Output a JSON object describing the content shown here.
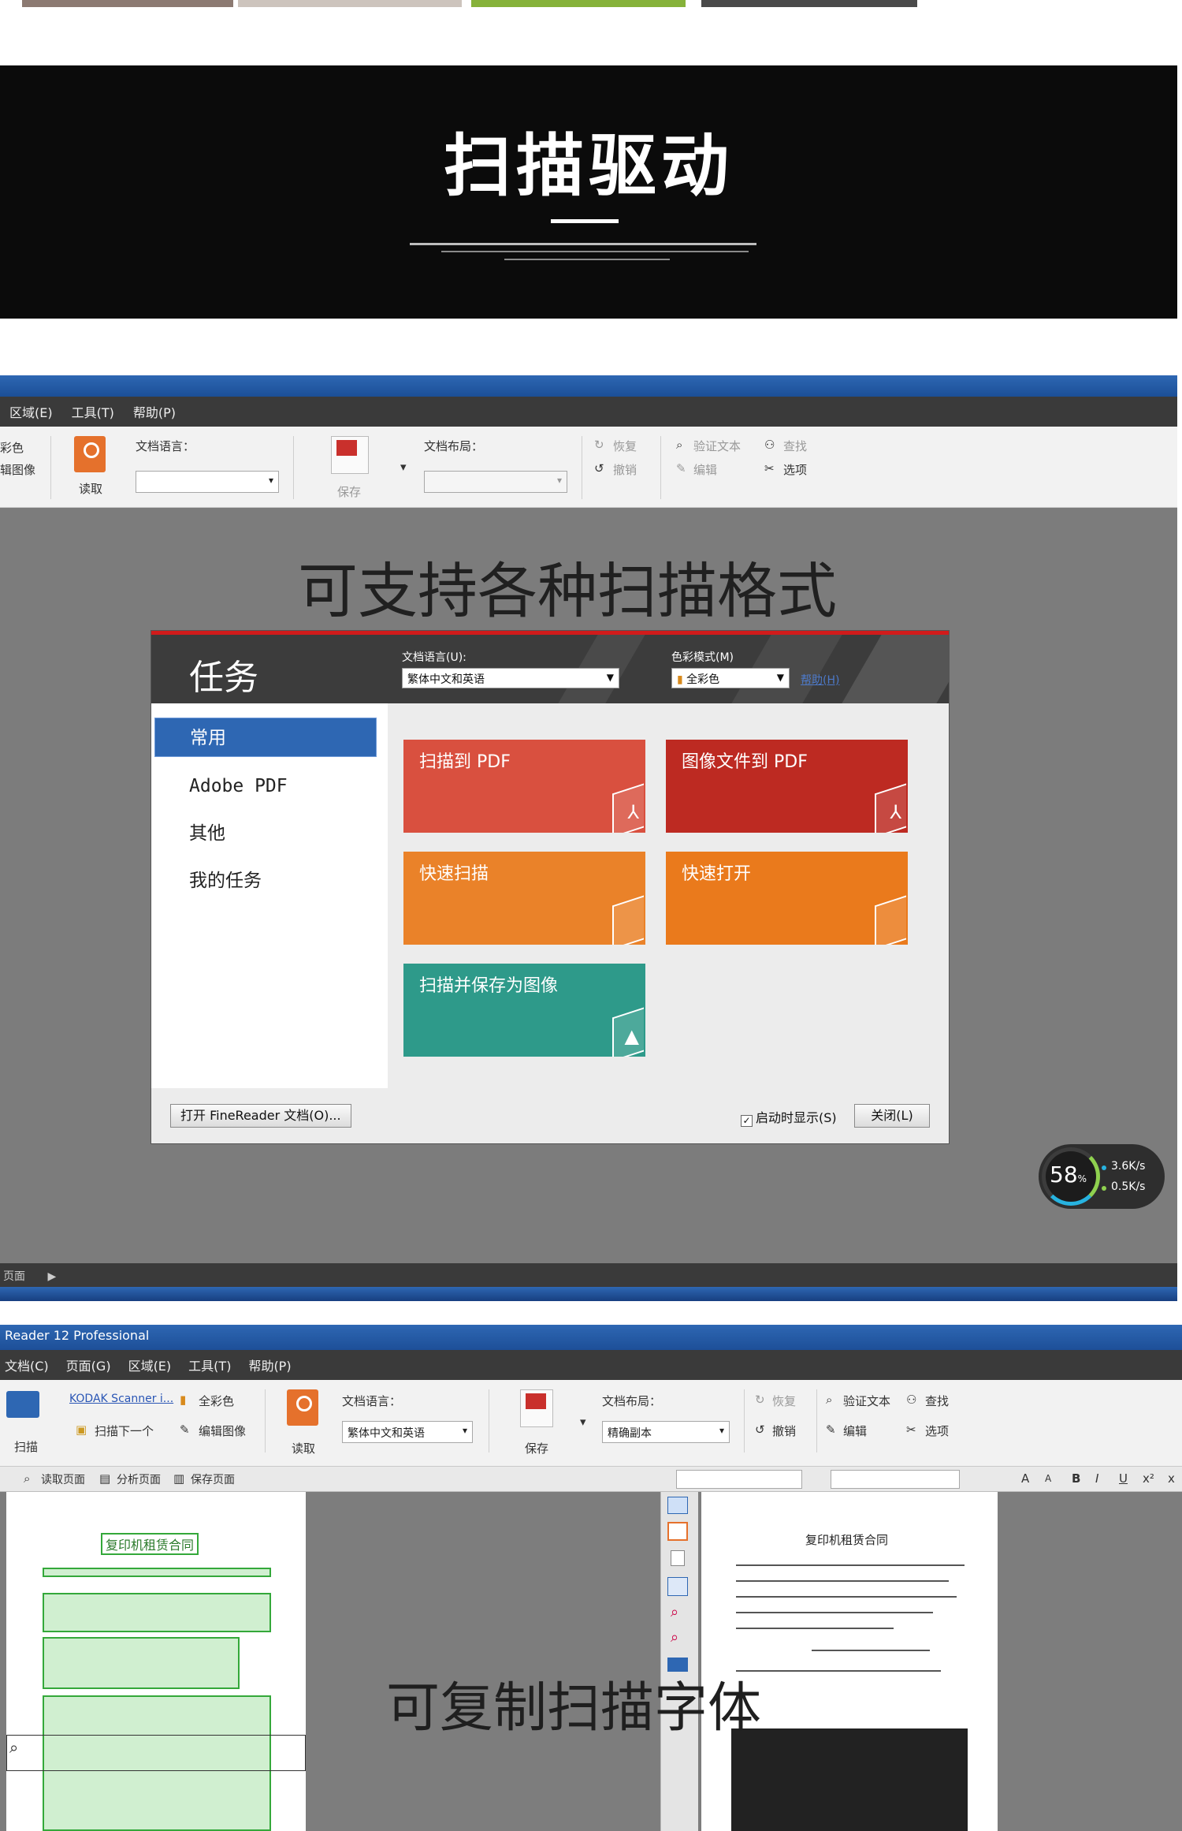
{
  "banner": {
    "title": "扫描驱动"
  },
  "shot1": {
    "menu": [
      "区域(E)",
      "工具(T)",
      "帮助(P)"
    ],
    "ribbon": {
      "left_cut_a": "彩色",
      "left_cut_b": "辑图像",
      "read_label": "读取",
      "doc_lang_label": "文档语言：",
      "save_label": "保存",
      "layout_label": "文档布局：",
      "redo_label": "恢复",
      "undo_label": "撤销",
      "verify_label": "验证文本",
      "edit_label": "编辑",
      "find_label": "查找",
      "options_label": "选项"
    },
    "heading": "可支持各种扫描格式",
    "dialog": {
      "title": "任务",
      "doc_lang_label": "文档语言(U):",
      "doc_lang_value": "繁体中文和英语",
      "color_mode_label": "色彩模式(M)",
      "color_mode_value": "全彩色",
      "help_link": "帮助(H)",
      "nav": [
        "常用",
        "Adobe PDF",
        "其他",
        "我的任务"
      ],
      "tiles": [
        {
          "label": "扫描到 PDF",
          "color": "#d9503f"
        },
        {
          "label": "图像文件到 PDF",
          "color": "#bd2a22"
        },
        {
          "label": "快速扫描",
          "color": "#ea8229"
        },
        {
          "label": "快速打开",
          "color": "#ea7a1c"
        },
        {
          "label": "扫描并保存为图像",
          "color": "#2e9a8a"
        }
      ],
      "open_button": "打开 FineReader 文档(O)...",
      "startup_checkbox": "启动时显示(S)",
      "close_button": "关闭(L)"
    },
    "net_widget": {
      "percent": "58",
      "unit": "%",
      "up": "3.6K/s",
      "down": "0.5K/s"
    },
    "status": "页面"
  },
  "shot2": {
    "title": "Reader 12 Professional",
    "menu": [
      "文档(C)",
      "页面(G)",
      "区域(E)",
      "工具(T)",
      "帮助(P)"
    ],
    "ribbon": {
      "scan_label": "扫描",
      "scanner_link": "KODAK Scanner i...",
      "full_color": "全彩色",
      "scan_next": "扫描下一个",
      "edit_image": "编辑图像",
      "read_label": "读取",
      "doc_lang_label": "文档语言：",
      "doc_lang_value": "繁体中文和英语",
      "save_label": "保存",
      "layout_label": "文档布局：",
      "layout_value": "精确副本",
      "redo_label": "恢复",
      "undo_label": "撤销",
      "verify_label": "验证文本",
      "edit_label": "编辑",
      "find_label": "查找",
      "options_label": "选项"
    },
    "toolbar": {
      "read_page": "读取页面",
      "analyze_page": "分析页面",
      "save_page": "保存页面",
      "format_buttons": [
        "A",
        "A",
        "B",
        "I",
        "U",
        "x²",
        "x"
      ]
    },
    "doc_left_title": "复印机租赁合同",
    "doc_right_title": "复印机租赁合同",
    "heading": "可复制扫描字体"
  },
  "colors": {
    "accent_blue": "#2e67b3",
    "dialog_red": "#d11b1b"
  }
}
